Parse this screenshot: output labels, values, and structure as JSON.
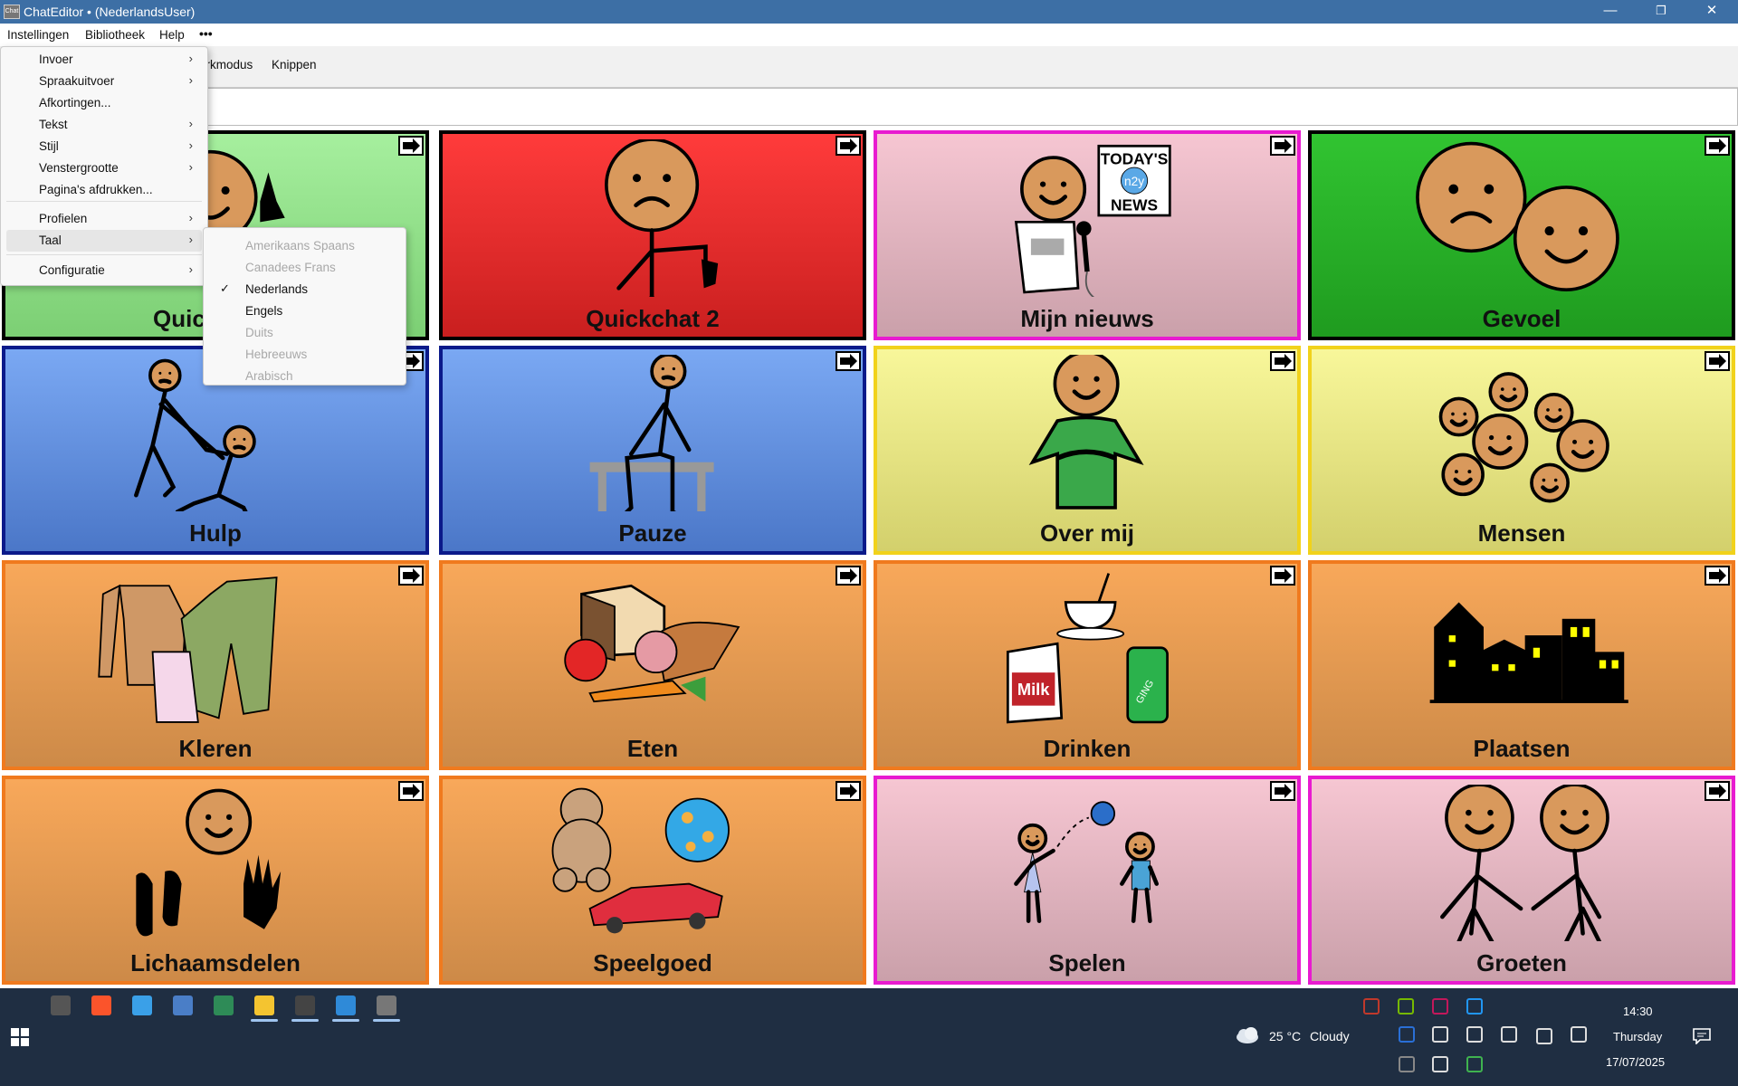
{
  "window": {
    "title": "ChatEditor • (NederlandsUser)",
    "app_icon_text": "Chat",
    "minimize": "—",
    "maximize": "❐",
    "close": "✕"
  },
  "menubar": {
    "items": [
      "Instellingen",
      "Bibliotheek",
      "Help",
      "•••"
    ]
  },
  "toolbar": {
    "items": [
      "erkmodus",
      "Knippen"
    ]
  },
  "menu": {
    "items": [
      {
        "label": "Invoer",
        "submenu": true
      },
      {
        "label": "Spraakuitvoer",
        "submenu": true
      },
      {
        "label": "Afkortingen...",
        "submenu": false
      },
      {
        "label": "Tekst",
        "submenu": true
      },
      {
        "label": "Stijl",
        "submenu": true
      },
      {
        "label": "Venstergrootte",
        "submenu": true
      },
      {
        "label": "Pagina's afdrukken...",
        "submenu": false
      },
      {
        "label": "Profielen",
        "submenu": true
      },
      {
        "label": "Taal",
        "submenu": true,
        "highlighted": true
      },
      {
        "label": "Configuratie",
        "submenu": true
      }
    ],
    "chevron": "›"
  },
  "language_submenu": {
    "items": [
      {
        "label": "Amerikaans Spaans",
        "enabled": false,
        "checked": false
      },
      {
        "label": "Canadees Frans",
        "enabled": false,
        "checked": false
      },
      {
        "label": "Nederlands",
        "enabled": true,
        "checked": true
      },
      {
        "label": "Engels",
        "enabled": true,
        "checked": false
      },
      {
        "label": "Duits",
        "enabled": false,
        "checked": false
      },
      {
        "label": "Hebreeuws",
        "enabled": false,
        "checked": false
      },
      {
        "label": "Arabisch",
        "enabled": false,
        "checked": false
      }
    ],
    "check_glyph": "✓"
  },
  "grid": {
    "cells": [
      {
        "label": "Quickchat 1",
        "visible_label": "Quic",
        "bg_top": "#a6ef9e",
        "bg_bottom": "#7ccf74",
        "border": "#000000",
        "icon": "quickchat-thumbs-up-icon"
      },
      {
        "label": "Quickchat 2",
        "bg_top": "#ff3b3b",
        "bg_bottom": "#c91f1f",
        "border": "#000000",
        "icon": "quickchat-thumbs-down-icon"
      },
      {
        "label": "Mijn nieuws",
        "bg_top": "#f6c6d2",
        "bg_bottom": "#caa0aa",
        "border": "#e81bd0",
        "icon": "news-reporter-icon"
      },
      {
        "label": "Gevoel",
        "bg_top": "#31c431",
        "bg_bottom": "#1f9b1f",
        "border": "#000000",
        "icon": "feelings-faces-icon"
      },
      {
        "label": "Hulp",
        "bg_top": "#7aa8f3",
        "bg_bottom": "#4b77c8",
        "border": "#0b1a8a",
        "icon": "help-person-icon"
      },
      {
        "label": "Pauze",
        "bg_top": "#7aa8f3",
        "bg_bottom": "#4b77c8",
        "border": "#0b1a8a",
        "icon": "sitting-person-icon"
      },
      {
        "label": "Over mij",
        "bg_top": "#f8f79a",
        "bg_bottom": "#d3d06c",
        "border": "#f1d21b",
        "icon": "about-me-person-icon"
      },
      {
        "label": "Mensen",
        "bg_top": "#f8f79a",
        "bg_bottom": "#d3d06c",
        "border": "#f1d21b",
        "icon": "people-faces-icon"
      },
      {
        "label": "Kleren",
        "bg_top": "#f8a85a",
        "bg_bottom": "#cd8a48",
        "border": "#f07a1e",
        "icon": "clothes-icon"
      },
      {
        "label": "Eten",
        "bg_top": "#f8a85a",
        "bg_bottom": "#cd8a48",
        "border": "#f07a1e",
        "icon": "food-icon"
      },
      {
        "label": "Drinken",
        "bg_top": "#f8a85a",
        "bg_bottom": "#cd8a48",
        "border": "#f07a1e",
        "icon": "drinks-icon"
      },
      {
        "label": "Plaatsen",
        "bg_top": "#f8a85a",
        "bg_bottom": "#cd8a48",
        "border": "#f07a1e",
        "icon": "city-buildings-icon"
      },
      {
        "label": "Lichaamsdelen",
        "bg_top": "#f8a85a",
        "bg_bottom": "#cd8a48",
        "border": "#f07a1e",
        "icon": "body-parts-icon"
      },
      {
        "label": "Speelgoed",
        "bg_top": "#f8a85a",
        "bg_bottom": "#cd8a48",
        "border": "#f07a1e",
        "icon": "toys-icon"
      },
      {
        "label": "Spelen",
        "bg_top": "#f6c6d2",
        "bg_bottom": "#caa0aa",
        "border": "#e81bd0",
        "icon": "children-playing-icon"
      },
      {
        "label": "Groeten",
        "bg_top": "#f6c6d2",
        "bg_bottom": "#caa0aa",
        "border": "#e81bd0",
        "icon": "handshake-icon"
      }
    ],
    "news_sign": [
      "TODAY'S",
      "n2y",
      "NEWS"
    ],
    "drink_labels": [
      "Milk",
      "GING"
    ]
  },
  "taskbar": {
    "weather": {
      "temp": "25 °C",
      "condition": "Cloudy"
    },
    "clock": {
      "time": "14:30",
      "day": "Thursday",
      "date": "17/07/2025"
    },
    "start_icon": "windows-start-icon",
    "pinned": [
      "steam-icon",
      "brave-icon",
      "remote-desktop-icon",
      "photos-icon",
      "notepad-icon",
      "file-explorer-icon",
      "terminal-icon",
      "vscode-icon",
      "chateditor-icon"
    ],
    "tray": [
      "tray-app-icon",
      "nvidia-icon",
      "tray-red-icon",
      "bluetooth-icon",
      "r-icon",
      "volume-icon",
      "battery-icon",
      "pen-icon",
      "keyboard-icon",
      "settings-icon",
      "wifi-icon",
      "headset-icon",
      "h-icon"
    ]
  }
}
